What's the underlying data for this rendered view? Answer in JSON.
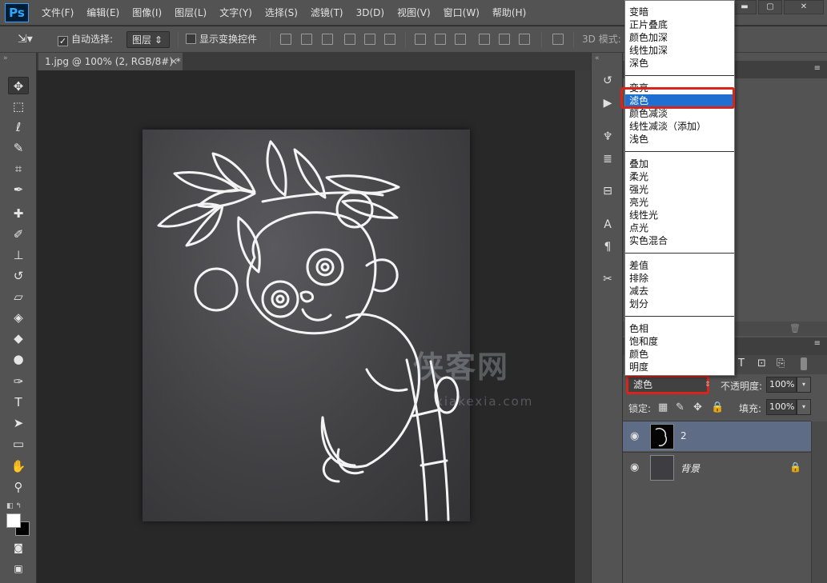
{
  "app": {
    "logo": "Ps"
  },
  "menubar": {
    "items": [
      "文件(F)",
      "编辑(E)",
      "图像(I)",
      "图层(L)",
      "文字(Y)",
      "选择(S)",
      "滤镜(T)",
      "3D(D)",
      "视图(V)",
      "窗口(W)",
      "帮助(H)"
    ]
  },
  "window_controls": {
    "minimize": "▬",
    "maximize": "▢",
    "close": "✕"
  },
  "options_bar": {
    "auto_select_label": "自动选择:",
    "auto_select_checked": true,
    "auto_select_target": "图层",
    "show_transform_label": "显示变换控件",
    "show_transform_checked": false,
    "mode_3d_label": "3D 模式:"
  },
  "document": {
    "tab_title": "1.jpg @ 100% (2, RGB/8#) *",
    "close_glyph": "✕"
  },
  "canvas": {
    "watermark": "侠客网",
    "watermark_url": "xiakexia.com"
  },
  "toolbox": {
    "icons": [
      "move-icon",
      "marquee-icon",
      "lasso-icon",
      "quick-select-icon",
      "crop-icon",
      "eyedropper-icon",
      "healing-icon",
      "brush-icon",
      "stamp-icon",
      "history-brush-icon",
      "eraser-icon",
      "paint-bucket-icon",
      "blur-icon",
      "dodge-icon",
      "pen-icon",
      "type-icon",
      "path-select-icon",
      "rectangle-icon",
      "hand-icon",
      "zoom-icon"
    ]
  },
  "blend_modes": {
    "groups": [
      [
        "变暗",
        "正片叠底",
        "颜色加深",
        "线性加深",
        "深色"
      ],
      [
        "变亮",
        "滤色",
        "颜色减淡",
        "线性减淡（添加）",
        "浅色"
      ],
      [
        "叠加",
        "柔光",
        "强光",
        "亮光",
        "线性光",
        "点光",
        "实色混合"
      ],
      [
        "差值",
        "排除",
        "减去",
        "划分"
      ],
      [
        "色相",
        "饱和度",
        "颜色",
        "明度"
      ]
    ],
    "selected": "滤色"
  },
  "layers_panel": {
    "blend_mode_value": "滤色",
    "opacity_label": "不透明度:",
    "opacity_value": "100%",
    "lock_label": "锁定:",
    "fill_label": "填充:",
    "fill_value": "100%",
    "layers": [
      {
        "name": "2",
        "visible": true,
        "selected": true,
        "locked": false
      },
      {
        "name": "背景",
        "visible": true,
        "selected": false,
        "locked": true
      }
    ]
  },
  "colors": {
    "highlight": "#d9241c",
    "selected_row": "#5e6d85",
    "list_selection": "#1e6fd0"
  }
}
